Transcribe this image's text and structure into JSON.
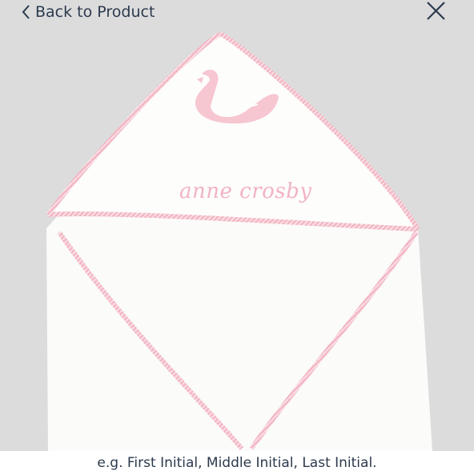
{
  "header": {
    "back_label": "Back to Product",
    "back_icon": "chevron-left-icon",
    "close_icon": "close-icon"
  },
  "preview": {
    "monogram_text": "anne crosby",
    "colors": {
      "accent_pink": "#f2b3c3",
      "towel_white": "#fbfbfa",
      "background": "#dcdcdd",
      "text": "#2c3a4d"
    }
  },
  "footer": {
    "hint": "e.g. First Initial, Middle Initial, Last Initial."
  }
}
